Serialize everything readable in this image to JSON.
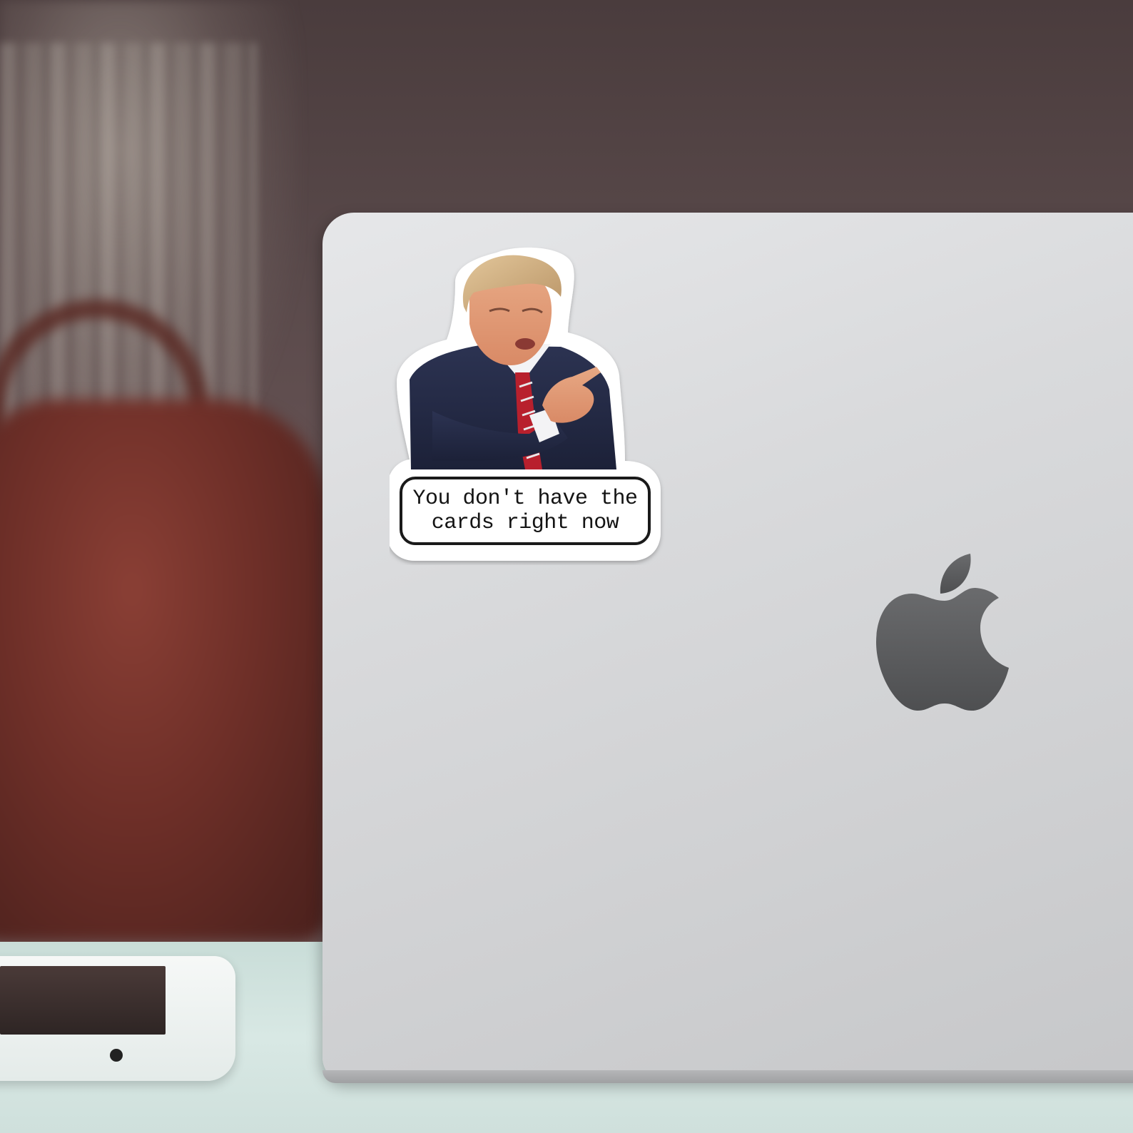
{
  "scene": {
    "description_colors": {
      "wall": "#5a4a4b",
      "bag": "#6e2f28",
      "desk": "#d8e8e4",
      "laptop_lid": "#d9dadc",
      "logo": "#5c5d5f"
    },
    "objects": [
      "laptop",
      "tablet",
      "sticker",
      "apple-logo",
      "bag"
    ]
  },
  "sticker": {
    "caption_line1": "You don't have the",
    "caption_line2": "cards right now"
  }
}
